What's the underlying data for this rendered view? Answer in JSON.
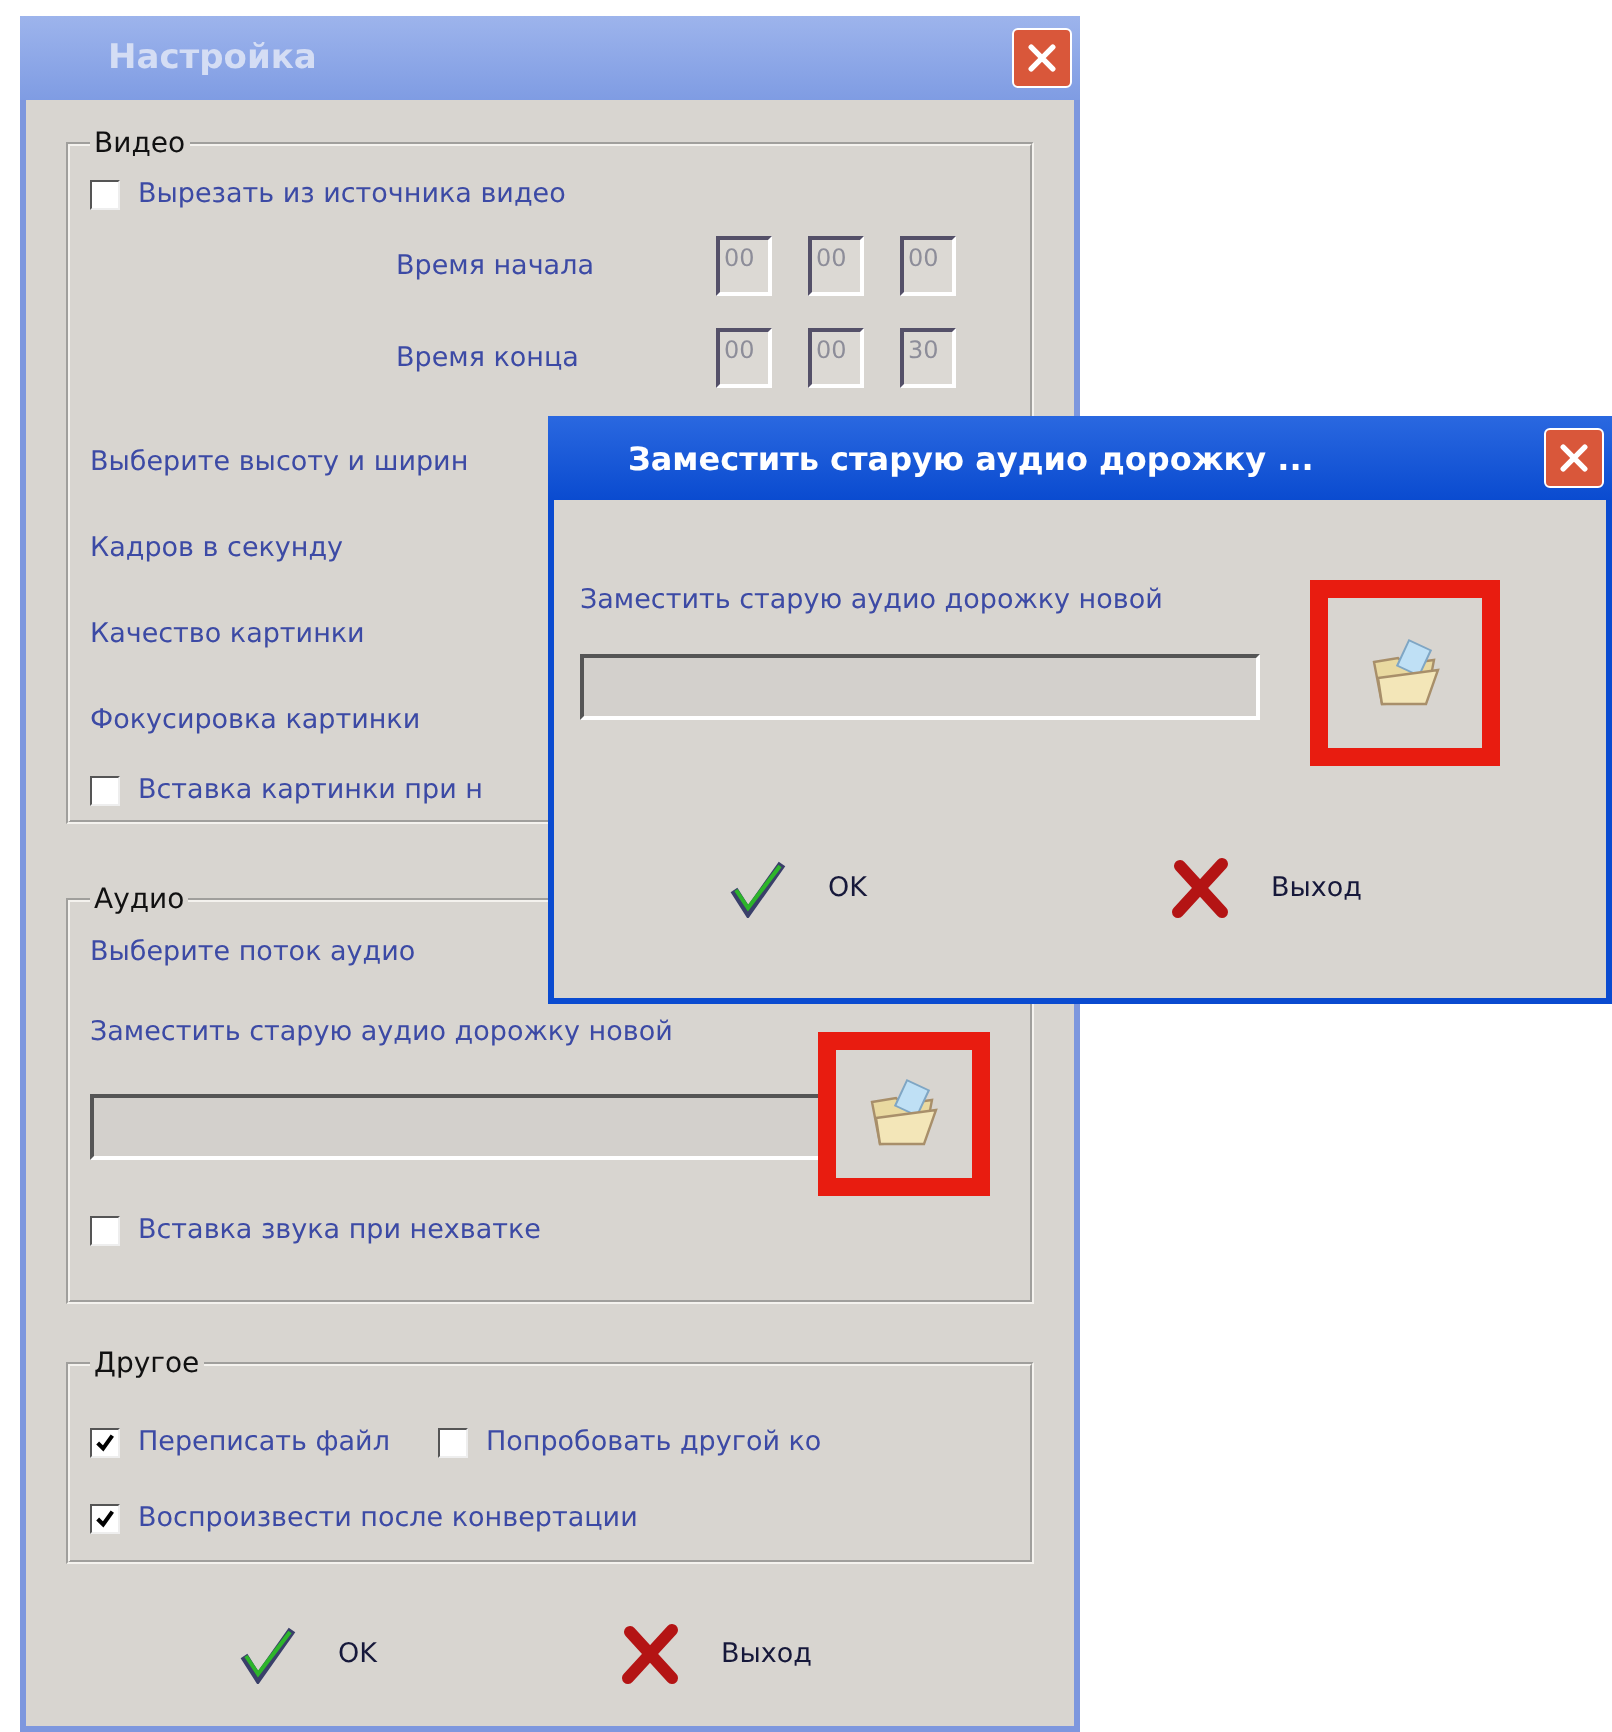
{
  "window": {
    "title": "Настройка"
  },
  "video": {
    "legend": "Видео",
    "cut_checkbox": {
      "label": "Вырезать из источника видео",
      "checked": false
    },
    "time_rows": [
      {
        "label": "Время начала",
        "fields": [
          "00",
          "00",
          "00"
        ]
      },
      {
        "label": "Время конца",
        "fields": [
          "00",
          "00",
          "30"
        ]
      }
    ],
    "labels": [
      "Выберите высоту и ширин",
      "Кадров в секунду",
      "Качество картинки",
      "Фокусировка картинки"
    ],
    "insert_checkbox": {
      "label": "Вставка картинки при н",
      "checked": false
    }
  },
  "audio": {
    "legend": "Аудио",
    "stream_label": "Выберите поток аудио",
    "replace_label": "Заместить старую аудио дорожку новой",
    "insert_checkbox": {
      "label": "Вставка звука при нехватке",
      "checked": false
    }
  },
  "other": {
    "legend": "Другое",
    "rows": [
      [
        {
          "label": "Переписать файл",
          "checked": true
        },
        {
          "label": "Попробовать другой ко",
          "checked": false
        }
      ],
      [
        {
          "label": "Воспроизвести после конвертации",
          "checked": true
        }
      ]
    ]
  },
  "buttons": [
    {
      "kind": "ok",
      "label": "OK"
    },
    {
      "kind": "exit",
      "label": "Выход"
    }
  ],
  "dialog": {
    "title": "Заместить старую аудио дорожку ...",
    "label": "Заместить старую аудио дорожку новой",
    "buttons": [
      {
        "kind": "ok",
        "label": "OK"
      },
      {
        "kind": "exit",
        "label": "Выход"
      }
    ]
  }
}
